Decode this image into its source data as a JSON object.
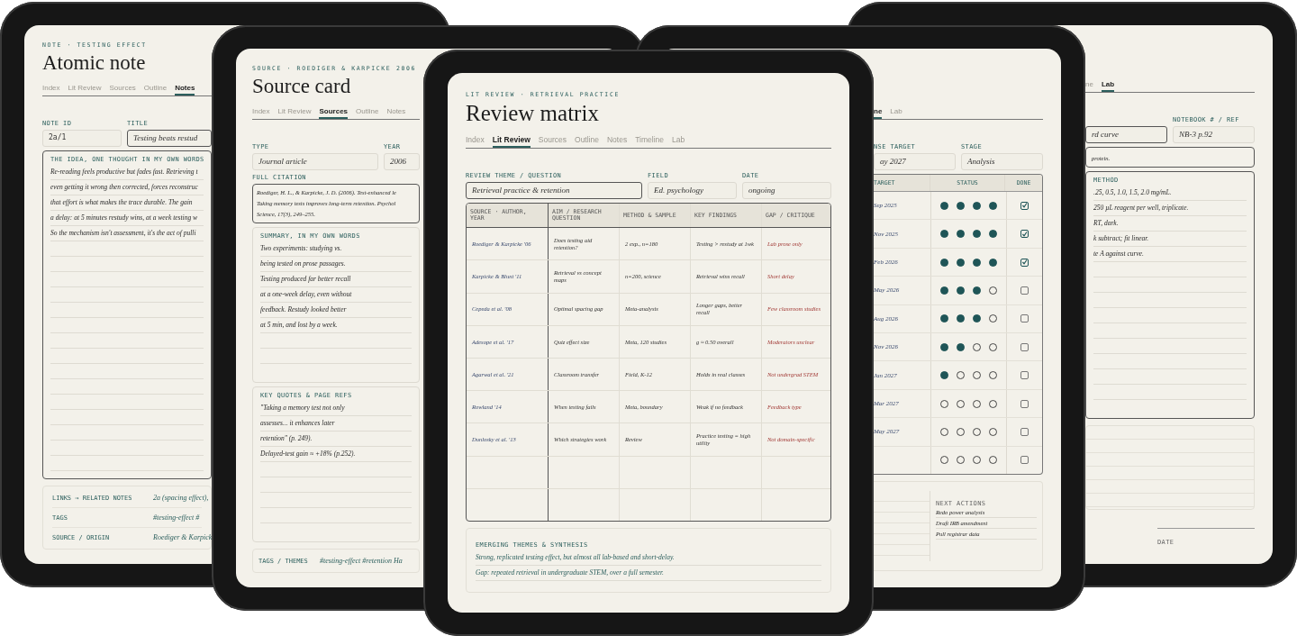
{
  "devices": [
    {
      "eyebrow": "NOTE · TESTING EFFECT",
      "title": "Atomic note",
      "tabs": [
        {
          "label": "Index",
          "selected": false
        },
        {
          "label": "Lit Review",
          "selected": false
        },
        {
          "label": "Sources",
          "selected": false
        },
        {
          "label": "Outline",
          "selected": false
        },
        {
          "label": "Notes",
          "selected": true
        }
      ],
      "sections": [
        {
          "kind": "fields",
          "fields": [
            {
              "label": "NOTE ID",
              "value": "2a/1",
              "focused": false
            },
            {
              "label": "TITLE",
              "value": "Testing beats restud",
              "focused": true
            }
          ]
        },
        {
          "kind": "lined",
          "heading": "THE IDEA, ONE THOUGHT IN MY OWN WORDS",
          "focused": true,
          "lines": [
            "Re-reading feels productive but fades fast. Retrieving t",
            "even getting it wrong then corrected, forces reconstruc",
            "that effort is what makes the trace durable. The gain",
            "a delay: at 5 minutes restudy wins, at a week testing w",
            "So the mechanism isn't assessment, it's the act of pulli"
          ]
        },
        {
          "kind": "meta",
          "rows": [
            {
              "label": "LINKS → RELATED NOTES",
              "value": "2a (spacing effect),"
            },
            {
              "label": "TAGS",
              "value": "#testing-effect #"
            },
            {
              "label": "SOURCE / ORIGIN",
              "value": "Roediger & Karpick"
            }
          ]
        }
      ]
    },
    {
      "eyebrow": "SOURCE · ROEDIGER & KARPICKE 2006",
      "title": "Source card",
      "tabs": [
        {
          "label": "Index",
          "selected": false
        },
        {
          "label": "Lit Review",
          "selected": false
        },
        {
          "label": "Sources",
          "selected": true
        },
        {
          "label": "Outline",
          "selected": false
        },
        {
          "label": "Notes",
          "selected": false
        }
      ],
      "sections": [
        {
          "kind": "fields",
          "fields": [
            {
              "label": "TYPE",
              "value": "Journal article",
              "focused": false
            },
            {
              "label": "YEAR",
              "value": "2006",
              "focused": false
            }
          ]
        },
        {
          "kind": "textarea",
          "label": "FULL CITATION",
          "focused": true,
          "lines": [
            "Roediger, H. L., & Karpicke, J. D. (2006). Test-enhanced le",
            "Taking memory tests improves long-term retention. Psychol",
            "Science, 17(3), 249–255."
          ]
        },
        {
          "kind": "lined",
          "heading": "SUMMARY, IN MY OWN WORDS",
          "focused": false,
          "lines": [
            "Two experiments: studying vs.",
            "being tested on prose passages.",
            "Testing produced far better recall",
            "at a one-week delay, even without",
            "feedback. Restudy looked better",
            "at 5 min, and lost by a week."
          ]
        },
        {
          "kind": "lined",
          "heading": "KEY QUOTES & PAGE REFS",
          "focused": false,
          "lines": [
            "\"Taking a memory test not only",
            "assesses... it enhances later",
            "retention\" (p. 249).",
            "Delayed-test gain ≈ +18% (p.252)."
          ]
        },
        {
          "kind": "meta",
          "rows": [
            {
              "label": "TAGS / THEMES",
              "value": "#testing-effect  #retention  Ha"
            }
          ]
        }
      ]
    },
    {
      "eyebrow": "LIT REVIEW · RETRIEVAL PRACTICE",
      "title": "Review matrix",
      "tabs": [
        {
          "label": "Index",
          "selected": false
        },
        {
          "label": "Lit Review",
          "selected": true
        },
        {
          "label": "Sources",
          "selected": false
        },
        {
          "label": "Outline",
          "selected": false
        },
        {
          "label": "Notes",
          "selected": false
        },
        {
          "label": "Timeline",
          "selected": false
        },
        {
          "label": "Lab",
          "selected": false
        }
      ],
      "sections": [
        {
          "kind": "fields",
          "fields": [
            {
              "label": "REVIEW THEME / QUESTION",
              "value": "Retrieval practice & retention",
              "focused": true
            },
            {
              "label": "FIELD",
              "value": "Ed. psychology",
              "focused": false
            },
            {
              "label": "DATE",
              "value": "ongoing",
              "focused": false
            }
          ]
        },
        {
          "kind": "matrix",
          "columns": [
            {
              "label": "SOURCE · AUTHOR, YEAR",
              "kind": "source"
            },
            {
              "label": "AIM / RESEARCH QUESTION",
              "kind": "text"
            },
            {
              "label": "METHOD & SAMPLE",
              "kind": "text"
            },
            {
              "label": "KEY FINDINGS",
              "kind": "text"
            },
            {
              "label": "GAP / CRITIQUE",
              "kind": "critique"
            }
          ],
          "rows": [
            [
              "Roediger & Karpicke '06",
              "Does testing aid retention?",
              "2 exp., n=180",
              "Testing > restudy at 1wk",
              "Lab prose only"
            ],
            [
              "Karpicke & Blunt '11",
              "Retrieval vs concept maps",
              "n=200, science",
              "Retrieval wins recall",
              "Short delay"
            ],
            [
              "Cepeda et al. '08",
              "Optimal spacing gap",
              "Meta-analysis",
              "Longer gaps, better recall",
              "Few classroom studies"
            ],
            [
              "Adesope et al. '17",
              "Quiz effect size",
              "Meta, 120 studies",
              "g ≈ 0.50 overall",
              "Moderators unclear"
            ],
            [
              "Agarwal et al. '21",
              "Classroom transfer",
              "Field, K-12",
              "Holds in real classes",
              "Not undergrad STEM"
            ],
            [
              "Rowland '14",
              "When testing fails",
              "Meta, boundary",
              "Weak if no feedback",
              "Feedback type"
            ],
            [
              "Dunlosky et al. '13",
              "Which strategies work",
              "Review",
              "Practice testing = high utility",
              "Not domain-specific"
            ]
          ]
        },
        {
          "kind": "synthesis",
          "heading": "EMERGING THEMES & SYNTHESIS",
          "lines": [
            "Strong, replicated testing effect, but almost all lab-based and short-delay.",
            "Gap: repeated retrieval in undergraduate STEM, over a full semester."
          ]
        }
      ]
    },
    {
      "tabs": [
        {
          "label": "ne",
          "selected": true
        },
        {
          "label": "Lab",
          "selected": false
        }
      ],
      "sections": [
        {
          "kind": "fields",
          "fields": [
            {
              "label": "NSE TARGET",
              "value": "ay 2027",
              "focused": false
            },
            {
              "label": "STAGE",
              "value": "Analysis",
              "focused": false
            }
          ]
        },
        {
          "kind": "status",
          "columns": [
            "TARGET",
            "STATUS",
            "DONE"
          ],
          "rows": [
            {
              "target": "Sep 2025",
              "stars": 4,
              "done": true
            },
            {
              "target": "Nov 2025",
              "stars": 4,
              "done": true
            },
            {
              "target": "Feb 2026",
              "stars": 4,
              "done": true
            },
            {
              "target": "May 2026",
              "stars": 3,
              "done": false
            },
            {
              "target": "Aug 2026",
              "stars": 3,
              "done": false
            },
            {
              "target": "Nov 2026",
              "stars": 2,
              "done": false
            },
            {
              "target": "Jan 2027",
              "stars": 1,
              "done": false
            },
            {
              "target": "Mar 2027",
              "stars": 0,
              "done": false
            },
            {
              "target": "May 2027",
              "stars": 0,
              "done": false
            },
            {
              "stars": 0,
              "done": false
            }
          ]
        },
        {
          "kind": "actions",
          "heading": "NEXT ACTIONS",
          "lines": [
            "Redo power analysis",
            "Draft IRB amendment",
            "Pull registrar data"
          ]
        }
      ]
    },
    {
      "tabs": [
        {
          "label": "ne",
          "selected": false
        },
        {
          "label": "Lab",
          "selected": true
        }
      ],
      "sections": [
        {
          "kind": "fields",
          "fields": [
            {
              "value": "rd curve",
              "focused": true
            },
            {
              "label": "NOTEBOOK # / REF",
              "value": "NB-3 p.92",
              "focused": false
            }
          ]
        },
        {
          "kind": "textarea",
          "focused": true,
          "lines": [
            "protein."
          ]
        },
        {
          "kind": "lined",
          "heading": "METHOD",
          "focused": true,
          "lines": [
            ".25, 0.5, 1.0, 1.5, 2.0 mg/mL.",
            "250 µL reagent per well, triplicate.",
            "RT, dark.",
            "k subtract; fit linear.",
            "te A against curve."
          ]
        },
        {
          "kind": "signoff",
          "label": "DATE"
        }
      ]
    }
  ]
}
